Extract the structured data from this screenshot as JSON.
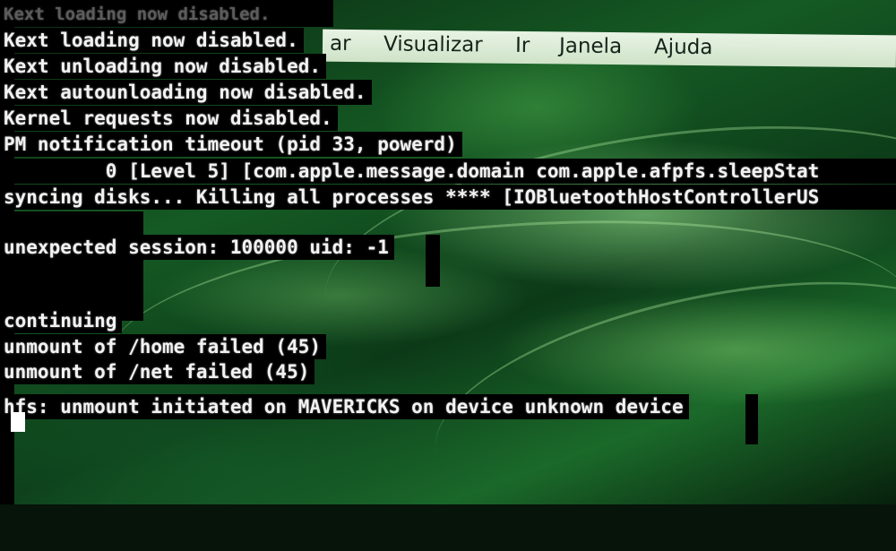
{
  "menubar": {
    "items": [
      "ar",
      "Visualizar",
      "Ir",
      "Janela",
      "Ajuda"
    ]
  },
  "console": {
    "top_cutoff": "Kext loading now disabled.",
    "lines": [
      "Kext loading now disabled.",
      "Kext unloading now disabled.",
      "Kext autounloading now disabled.",
      "Kernel requests now disabled.",
      "PM notification timeout (pid 33, powerd)",
      "         0 [Level 5] [com.apple.message.domain com.apple.afpfs.sleepStat",
      "syncing disks... Killing all processes **** [IOBluetoothHostControllerUS",
      "unexpected session: 100000 uid: -1",
      "continuing",
      "unmount of /home failed (45)",
      "unmount of /net failed (45)",
      "hfs: unmount initiated on MAVERICKS on device unknown device"
    ]
  },
  "colors": {
    "console_bg": "#000000",
    "console_text": "#f2f2f2",
    "menubar_bg": "#dcebd6",
    "wallpaper": "#155a24"
  },
  "icons": [
    "text-cursor-icon"
  ]
}
